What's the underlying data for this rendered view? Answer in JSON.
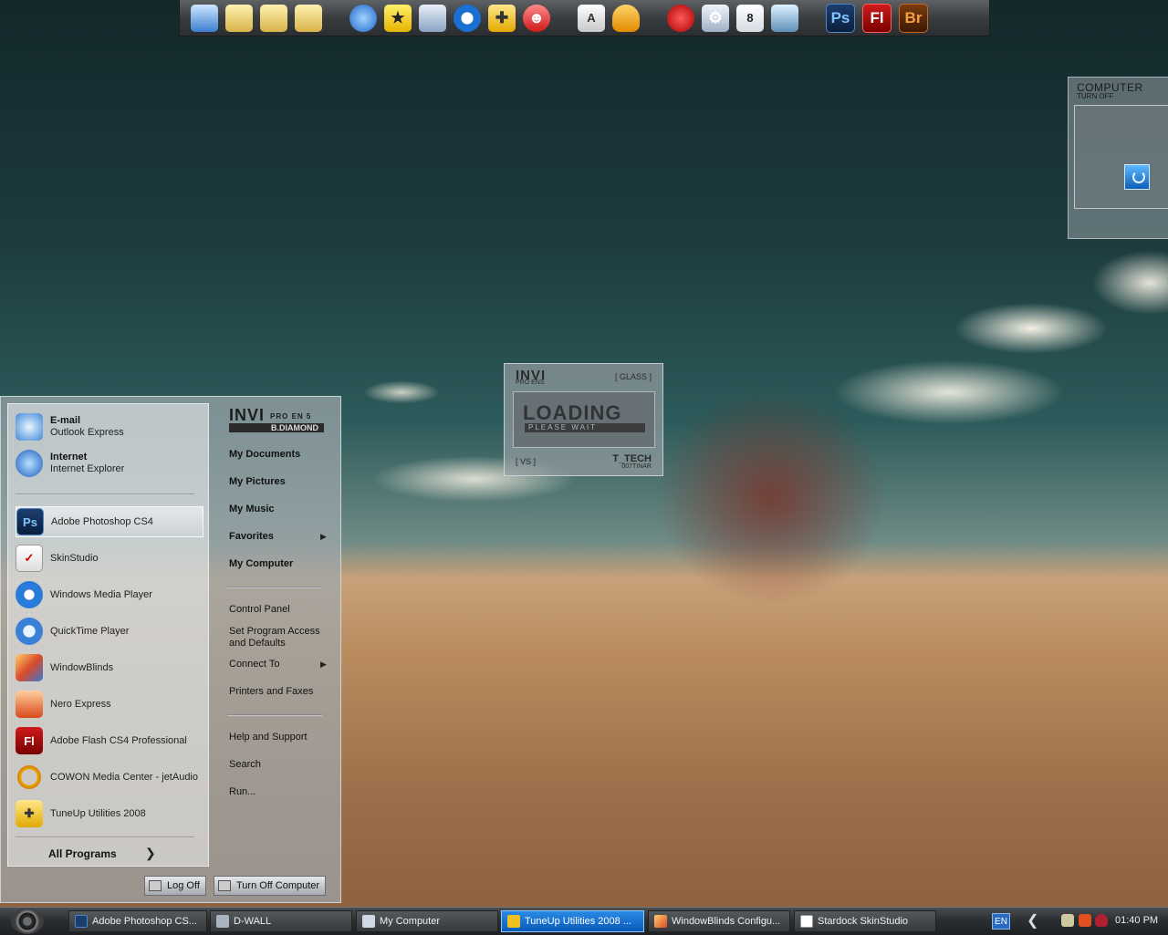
{
  "dock": {
    "icons": [
      "monitor-icon",
      "folder-icon",
      "folder-open-icon",
      "folder-tools-icon",
      "internet-explorer-icon",
      "aim-icon",
      "network-icon",
      "media-player-icon",
      "tuneup-icon",
      "yahoo-messenger-icon",
      "dictionary-icon",
      "helmet-icon",
      "ladybug-icon",
      "gears-icon",
      "calendar-icon",
      "database-icon",
      "photoshop-icon",
      "flash-icon",
      "bridge-icon"
    ],
    "calendar_day": "8",
    "ps_label": "Ps",
    "fl_label": "Fl",
    "br_label": "Br"
  },
  "computer_widget": {
    "title": "COMPUTER",
    "subtitle": "TURN OFF"
  },
  "loading_widget": {
    "logo": "INVI",
    "logo_sub": "PRO ENS",
    "glass": "[ GLASS ]",
    "loading": "LOADING",
    "please_wait": "PLEASE WAIT",
    "vs": "[ VS ]",
    "ttech": "T_TECH",
    "code": "007TINAR"
  },
  "start_menu": {
    "pinned": [
      {
        "title": "E-mail",
        "subtitle": "Outlook Express"
      },
      {
        "title": "Internet",
        "subtitle": "Internet Explorer"
      }
    ],
    "recent": [
      {
        "label": "Adobe Photoshop CS4",
        "icon_text": "Ps"
      },
      {
        "label": "SkinStudio",
        "icon_text": ""
      },
      {
        "label": "Windows Media Player",
        "icon_text": ""
      },
      {
        "label": "QuickTime Player",
        "icon_text": ""
      },
      {
        "label": "WindowBlinds",
        "icon_text": ""
      },
      {
        "label": "Nero Express",
        "icon_text": ""
      },
      {
        "label": "Adobe Flash CS4 Professional",
        "icon_text": "Fl"
      },
      {
        "label": "COWON Media Center - jetAudio",
        "icon_text": ""
      },
      {
        "label": "TuneUp Utilities 2008",
        "icon_text": ""
      }
    ],
    "all_programs": "All Programs",
    "all_programs_arrow": "❯",
    "logo_main": "INVI",
    "logo_main_side": "PRO EN 5",
    "logo_sub": "B.DIAMOND",
    "right_places": [
      "My Documents",
      "My Pictures",
      "My Music",
      "Favorites",
      "My Computer"
    ],
    "right_settings": [
      "Control Panel",
      "Set Program Access and Defaults",
      "Connect To",
      "Printers and Faxes"
    ],
    "right_help": [
      "Help and Support",
      "Search",
      "Run..."
    ],
    "arrow": "▶",
    "log_off": "Log Off",
    "turn_off": "Turn Off Computer"
  },
  "taskbar": {
    "buttons": [
      {
        "label": "Adobe Photoshop CS...",
        "active": false
      },
      {
        "label": "D-WALL",
        "active": false
      },
      {
        "label": "My Computer",
        "active": false
      },
      {
        "label": "TuneUp Utilities 2008 ...",
        "active": true
      },
      {
        "label": "WindowBlinds Configu...",
        "active": false
      },
      {
        "label": "Stardock SkinStudio",
        "active": false
      }
    ],
    "language": "EN",
    "chevron": "❮",
    "clock": "01:40 PM"
  }
}
